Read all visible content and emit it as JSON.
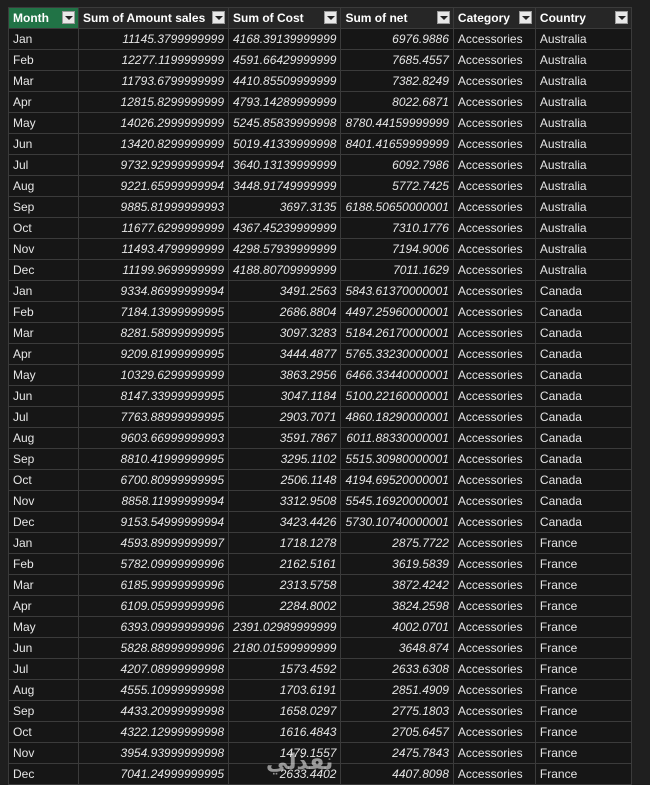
{
  "headers": [
    {
      "label": "Month"
    },
    {
      "label": "Sum of Amount sales"
    },
    {
      "label": "Sum of Cost"
    },
    {
      "label": "Sum of net"
    },
    {
      "label": "Category"
    },
    {
      "label": "Country"
    }
  ],
  "rows": [
    [
      "Jan",
      "11145.3799999999",
      "4168.39139999999",
      "6976.9886",
      "Accessories",
      "Australia"
    ],
    [
      "Feb",
      "12277.1199999999",
      "4591.66429999999",
      "7685.4557",
      "Accessories",
      "Australia"
    ],
    [
      "Mar",
      "11793.6799999999",
      "4410.85509999999",
      "7382.8249",
      "Accessories",
      "Australia"
    ],
    [
      "Apr",
      "12815.8299999999",
      "4793.14289999999",
      "8022.6871",
      "Accessories",
      "Australia"
    ],
    [
      "May",
      "14026.2999999999",
      "5245.85839999998",
      "8780.44159999999",
      "Accessories",
      "Australia"
    ],
    [
      "Jun",
      "13420.8299999999",
      "5019.41339999998",
      "8401.41659999999",
      "Accessories",
      "Australia"
    ],
    [
      "Jul",
      "9732.92999999994",
      "3640.13139999999",
      "6092.7986",
      "Accessories",
      "Australia"
    ],
    [
      "Aug",
      "9221.65999999994",
      "3448.91749999999",
      "5772.7425",
      "Accessories",
      "Australia"
    ],
    [
      "Sep",
      "9885.81999999993",
      "3697.3135",
      "6188.50650000001",
      "Accessories",
      "Australia"
    ],
    [
      "Oct",
      "11677.6299999999",
      "4367.45239999999",
      "7310.1776",
      "Accessories",
      "Australia"
    ],
    [
      "Nov",
      "11493.4799999999",
      "4298.57939999999",
      "7194.9006",
      "Accessories",
      "Australia"
    ],
    [
      "Dec",
      "11199.9699999999",
      "4188.80709999999",
      "7011.1629",
      "Accessories",
      "Australia"
    ],
    [
      "Jan",
      "9334.86999999994",
      "3491.2563",
      "5843.61370000001",
      "Accessories",
      "Canada"
    ],
    [
      "Feb",
      "7184.13999999995",
      "2686.8804",
      "4497.25960000001",
      "Accessories",
      "Canada"
    ],
    [
      "Mar",
      "8281.58999999995",
      "3097.3283",
      "5184.26170000001",
      "Accessories",
      "Canada"
    ],
    [
      "Apr",
      "9209.81999999995",
      "3444.4877",
      "5765.33230000001",
      "Accessories",
      "Canada"
    ],
    [
      "May",
      "10329.6299999999",
      "3863.2956",
      "6466.33440000001",
      "Accessories",
      "Canada"
    ],
    [
      "Jun",
      "8147.33999999995",
      "3047.1184",
      "5100.22160000001",
      "Accessories",
      "Canada"
    ],
    [
      "Jul",
      "7763.88999999995",
      "2903.7071",
      "4860.18290000001",
      "Accessories",
      "Canada"
    ],
    [
      "Aug",
      "9603.66999999993",
      "3591.7867",
      "6011.88330000001",
      "Accessories",
      "Canada"
    ],
    [
      "Sep",
      "8810.41999999995",
      "3295.1102",
      "5515.30980000001",
      "Accessories",
      "Canada"
    ],
    [
      "Oct",
      "6700.80999999995",
      "2506.1148",
      "4194.69520000001",
      "Accessories",
      "Canada"
    ],
    [
      "Nov",
      "8858.11999999994",
      "3312.9508",
      "5545.16920000001",
      "Accessories",
      "Canada"
    ],
    [
      "Dec",
      "9153.54999999994",
      "3423.4426",
      "5730.10740000001",
      "Accessories",
      "Canada"
    ],
    [
      "Jan",
      "4593.89999999997",
      "1718.1278",
      "2875.7722",
      "Accessories",
      "France"
    ],
    [
      "Feb",
      "5782.09999999996",
      "2162.5161",
      "3619.5839",
      "Accessories",
      "France"
    ],
    [
      "Mar",
      "6185.99999999996",
      "2313.5758",
      "3872.4242",
      "Accessories",
      "France"
    ],
    [
      "Apr",
      "6109.05999999996",
      "2284.8002",
      "3824.2598",
      "Accessories",
      "France"
    ],
    [
      "May",
      "6393.09999999996",
      "2391.02989999999",
      "4002.0701",
      "Accessories",
      "France"
    ],
    [
      "Jun",
      "5828.88999999996",
      "2180.01599999999",
      "3648.874",
      "Accessories",
      "France"
    ],
    [
      "Jul",
      "4207.08999999998",
      "1573.4592",
      "2633.6308",
      "Accessories",
      "France"
    ],
    [
      "Aug",
      "4555.10999999998",
      "1703.6191",
      "2851.4909",
      "Accessories",
      "France"
    ],
    [
      "Sep",
      "4433.20999999998",
      "1658.0297",
      "2775.1803",
      "Accessories",
      "France"
    ],
    [
      "Oct",
      "4322.12999999998",
      "1616.4843",
      "2705.6457",
      "Accessories",
      "France"
    ],
    [
      "Nov",
      "3954.93999999998",
      "1479.1557",
      "2475.7843",
      "Accessories",
      "France"
    ],
    [
      "Dec",
      "7041.24999999995",
      "2633.4402",
      "4407.8098",
      "Accessories",
      "France"
    ]
  ],
  "watermark": "نفذلي",
  "colors": {
    "header_active": "#217346",
    "background": "#1f1f1f",
    "cell": "#161616",
    "grid": "#3b3b3b"
  }
}
